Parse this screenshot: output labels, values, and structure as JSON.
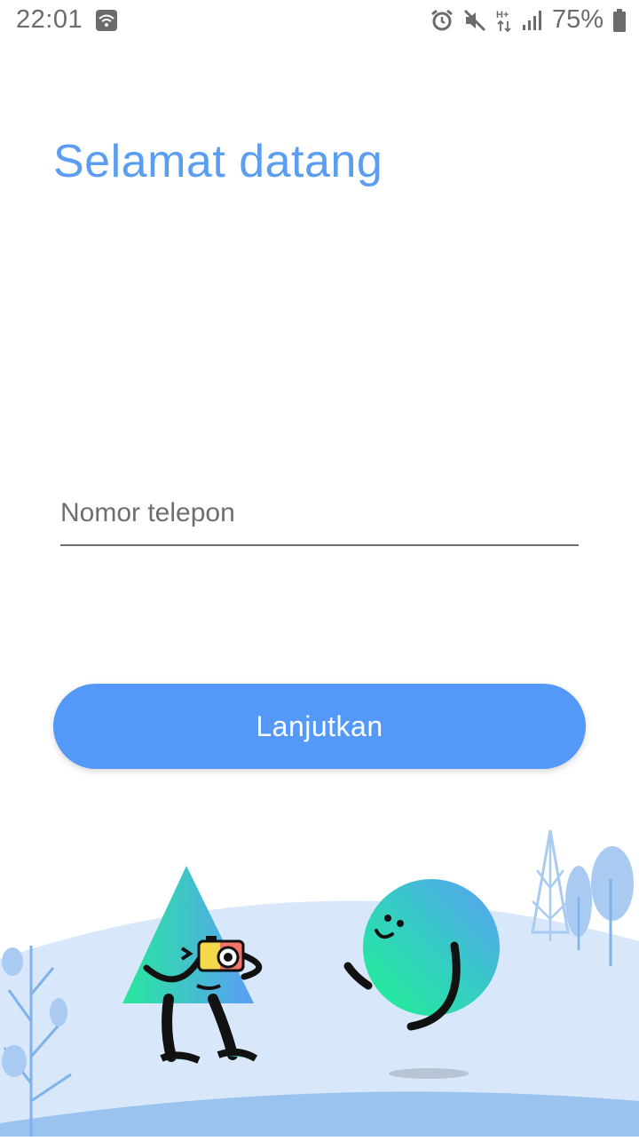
{
  "status_bar": {
    "time": "22:01",
    "battery": "75%",
    "icons": [
      "wifi-icon",
      "alarm-icon",
      "mute-icon",
      "hplus-data-icon",
      "signal-icon",
      "battery-icon"
    ]
  },
  "header": {
    "title": "Selamat datang"
  },
  "phone_input": {
    "placeholder": "Nomor telepon",
    "value": ""
  },
  "actions": {
    "continue_label": "Lanjutkan"
  },
  "illustration": {
    "name": "welcome-characters-illustration"
  },
  "colors": {
    "accent": "#5499f7",
    "title": "#5a9df1",
    "ground": "#d9e7fb"
  }
}
